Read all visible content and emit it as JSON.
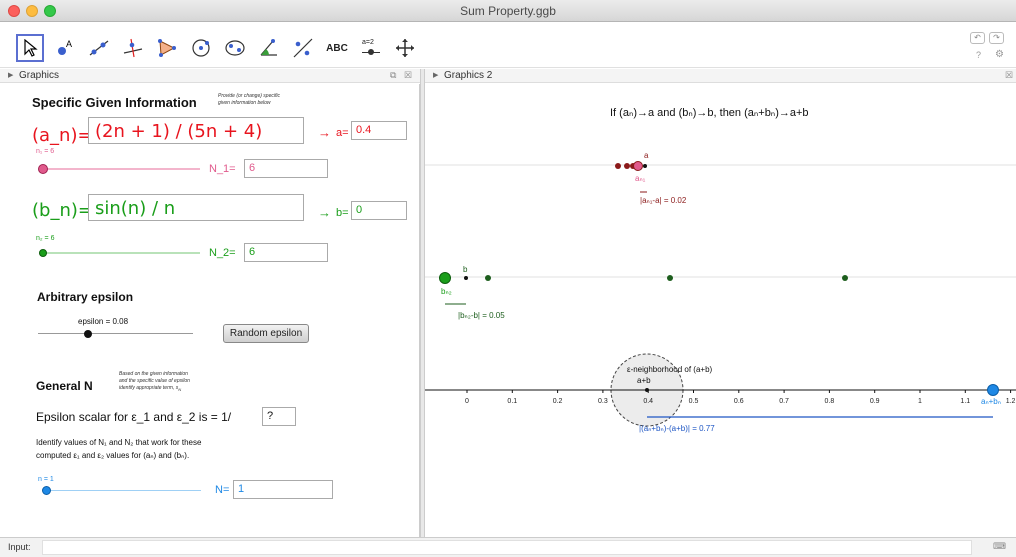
{
  "window": {
    "title": "Sum Property.ggb"
  },
  "toolbar": {
    "tools": [
      "move-tool",
      "point-tool",
      "line-tool",
      "perpendicular-tool",
      "polygon-tool",
      "circle-tool",
      "ellipse-tool",
      "angle-tool",
      "reflect-tool",
      "text-tool",
      "slider-tool",
      "move-graphics-tool"
    ],
    "text_tool_label": "ABC",
    "slider_tool_label": "a=2",
    "help": "?"
  },
  "panels": {
    "graphics1_title": "Graphics",
    "graphics2_title": "Graphics 2"
  },
  "g1": {
    "heading": "Specific Given Information",
    "heading_note_1": "Provide (or change) specific",
    "heading_note_2": "given information below",
    "an_label": "(a_n)=",
    "an_value": "(2n + 1) / (5n + 4)",
    "a_arrow": "→",
    "a_label": "a=",
    "a_value": "0.4",
    "n1_slider_label": "n₁ = 6",
    "n1_slider_value": 6,
    "N1_label": "N_1=",
    "N1_value": "6",
    "bn_label": "(b_n)=",
    "bn_value": "sin(n) / n",
    "b_arrow": "→",
    "b_label": "b=",
    "b_value": "0",
    "n2_slider_label": "n₂ = 6",
    "n2_slider_value": 6,
    "N2_label": "N_2=",
    "N2_value": "6",
    "epsilon_heading": "Arbitrary epsilon",
    "epsilon_slider_label": "epsilon = 0.08",
    "epsilon_value": 0.08,
    "random_button": "Random epsilon",
    "general_heading": "General N",
    "general_note_1": "Based on the given information",
    "general_note_2": "and the specific value of epsilon",
    "general_note_3": "identify appropriate term, s",
    "general_note_sub": "N",
    "scalar_prompt": "Epsilon scalar for ε_1 and ε_2 is = 1/",
    "scalar_value": "?",
    "identify_line1": "Identify values of N₁ and N₂ that work for these",
    "identify_line2": "computed ε₁ and ε₂ values for (aₙ) and (bₙ).",
    "n_slider_label": "n = 1",
    "n_value": 1,
    "N_label": "N=",
    "N_value": "1"
  },
  "g2": {
    "theorem": "If (aₙ)→a and (bₙ)→b, then (aₙ+bₙ)→a+b",
    "a_point_label": "a",
    "an1_label": "aₙ₁",
    "an1_diff": "|aₙ₁-a| = 0.02",
    "b_point_label": "b",
    "bn2_label": "bₙ₂",
    "bn2_diff": "|bₙ₂-b| = 0.05",
    "neighborhood_label": "ε-neighborhood of (a+b)",
    "apb_label": "a+b",
    "anbn_label": "aₙ+bₙ",
    "sum_diff": "|(aₙ+bₙ)-(a+b)| = 0.77",
    "axis_ticks": [
      "0",
      "0.1",
      "0.2",
      "0.3",
      "0.4",
      "0.5",
      "0.6",
      "0.7",
      "0.8",
      "0.9",
      "1",
      "1.1",
      "1.2"
    ]
  },
  "inputbar": {
    "label": "Input:"
  },
  "colors": {
    "red": "#e8141e",
    "pink": "#e05a8c",
    "green": "#1a9e1a",
    "darkgreen": "#1d5e1d",
    "blue": "#1e88e5",
    "darkred": "#8b1a1a"
  }
}
